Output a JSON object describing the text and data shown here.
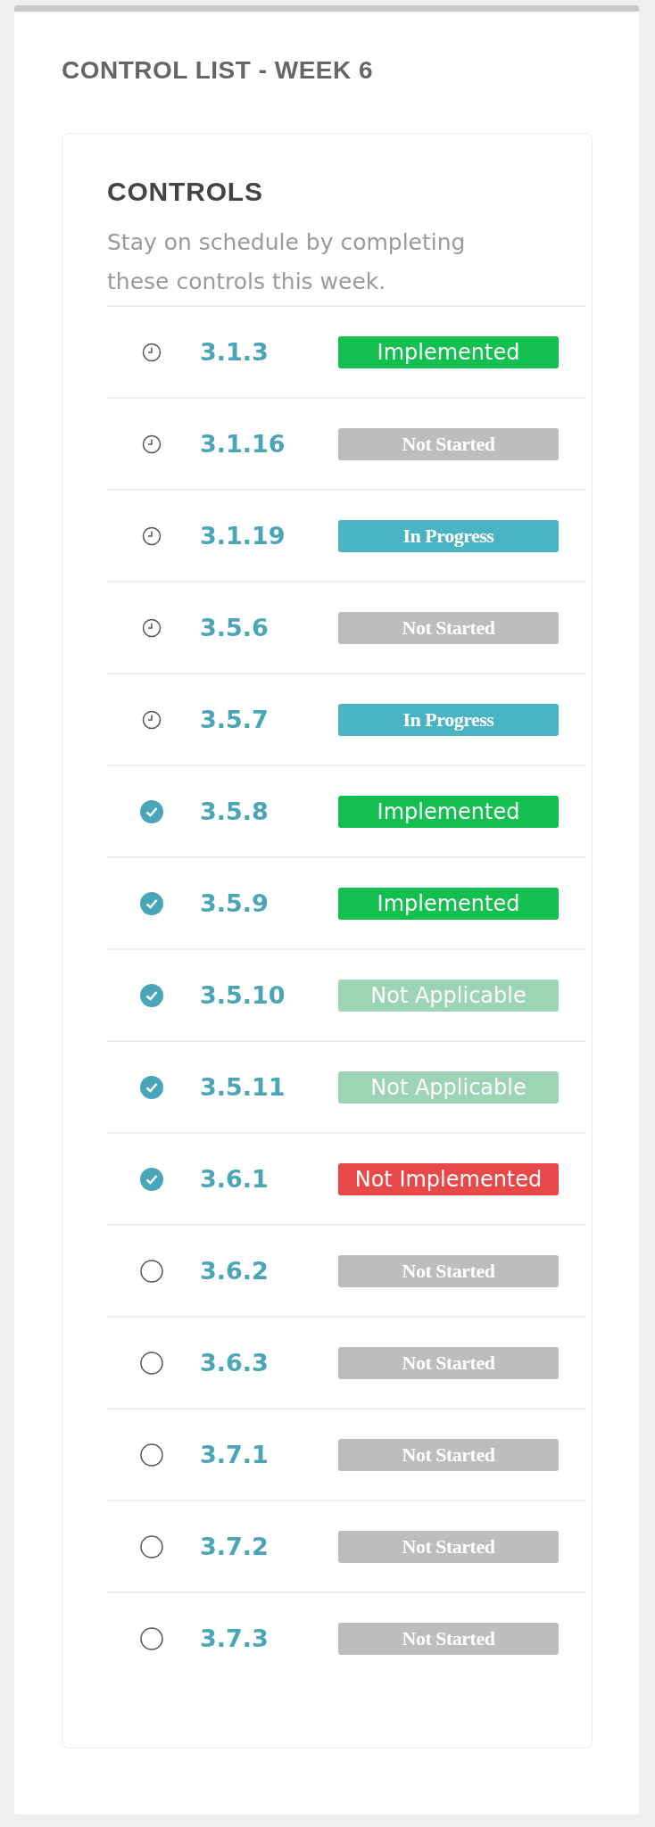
{
  "panel": {
    "title": "CONTROL LIST - WEEK 6"
  },
  "card": {
    "title": "CONTROLS",
    "description": "Stay on schedule by completing these controls this week."
  },
  "controls": [
    {
      "kind": "pending",
      "number": "3.1.3",
      "status": {
        "kind": "implemented",
        "label": "Implemented",
        "color": "#13bf4f"
      }
    },
    {
      "kind": "pending",
      "number": "3.1.16",
      "status": {
        "kind": "not_started",
        "label": "Not Started",
        "color": "#bdbdbd"
      }
    },
    {
      "kind": "pending",
      "number": "3.1.19",
      "status": {
        "kind": "in_progress",
        "label": "In Progress",
        "color": "#4ab4c4"
      }
    },
    {
      "kind": "pending",
      "number": "3.5.6",
      "status": {
        "kind": "not_started",
        "label": "Not Started",
        "color": "#bdbdbd"
      }
    },
    {
      "kind": "pending",
      "number": "3.5.7",
      "status": {
        "kind": "in_progress",
        "label": "In Progress",
        "color": "#4ab4c4"
      }
    },
    {
      "kind": "done",
      "number": "3.5.8",
      "status": {
        "kind": "implemented",
        "label": "Implemented",
        "color": "#13bf4f"
      }
    },
    {
      "kind": "done",
      "number": "3.5.9",
      "status": {
        "kind": "implemented",
        "label": "Implemented",
        "color": "#13bf4f"
      }
    },
    {
      "kind": "done",
      "number": "3.5.10",
      "status": {
        "kind": "not_applicable",
        "label": "Not Applicable",
        "color": "#9dd4b4"
      }
    },
    {
      "kind": "done",
      "number": "3.5.11",
      "status": {
        "kind": "not_applicable",
        "label": "Not Applicable",
        "color": "#9dd4b4"
      }
    },
    {
      "kind": "done",
      "number": "3.6.1",
      "status": {
        "kind": "not_implemented",
        "label": "Not Implemented",
        "color": "#e84848"
      }
    },
    {
      "kind": "open",
      "number": "3.6.2",
      "status": {
        "kind": "not_started",
        "label": "Not Started",
        "color": "#bdbdbd"
      }
    },
    {
      "kind": "open",
      "number": "3.6.3",
      "status": {
        "kind": "not_started",
        "label": "Not Started",
        "color": "#bdbdbd"
      }
    },
    {
      "kind": "open",
      "number": "3.7.1",
      "status": {
        "kind": "not_started",
        "label": "Not Started",
        "color": "#bdbdbd"
      }
    },
    {
      "kind": "open",
      "number": "3.7.2",
      "status": {
        "kind": "not_started",
        "label": "Not Started",
        "color": "#bdbdbd"
      }
    },
    {
      "kind": "open",
      "number": "3.7.3",
      "status": {
        "kind": "not_started",
        "label": "Not Started",
        "color": "#bdbdbd"
      }
    }
  ]
}
